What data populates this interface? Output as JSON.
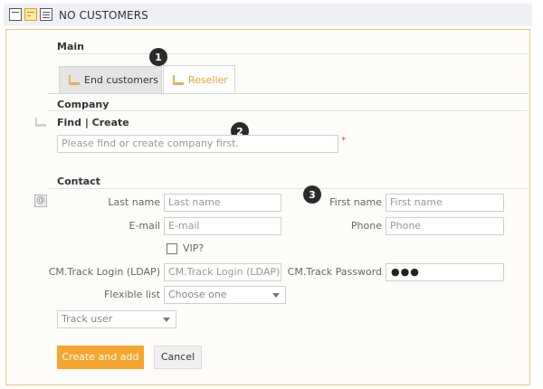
{
  "header": {
    "title": "NO CUSTOMERS",
    "view_icons": [
      "card-view-icon",
      "form-view-icon",
      "list-view-icon"
    ]
  },
  "main": {
    "section_label": "Main"
  },
  "tabs": [
    {
      "label": "End customers",
      "active": false
    },
    {
      "label": "Reseller",
      "active": true
    }
  ],
  "badges": [
    "1",
    "2",
    "3"
  ],
  "company": {
    "section_label": "Company",
    "find_create_label": "Find | Create",
    "input_placeholder": "Please find or create company first.",
    "required_mark": "*"
  },
  "contact": {
    "section_label": "Contact",
    "last_name_label": "Last name",
    "last_name_placeholder": "Last name",
    "first_name_label": "First name",
    "first_name_placeholder": "First name",
    "email_label": "E-mail",
    "email_placeholder": "E-mail",
    "phone_label": "Phone",
    "phone_placeholder": "Phone",
    "vip_label": "VIP?",
    "login_label": "CM.Track Login (LDAP)",
    "login_placeholder": "CM.Track Login (LDAP)",
    "password_label": "CM.Track Password",
    "password_value": "●●●",
    "flexible_label": "Flexible list",
    "flexible_value": "Choose one",
    "track_user_value": "Track user"
  },
  "actions": {
    "create_label": "Create and add",
    "cancel_label": "Cancel"
  },
  "colors": {
    "accent": "#f6a52f",
    "panel_border": "#f5c57a",
    "required": "#e23b3b",
    "header_bg": "#eef0f5"
  }
}
